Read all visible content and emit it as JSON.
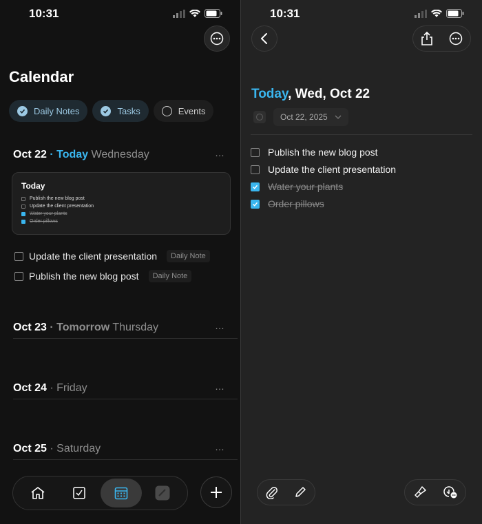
{
  "left": {
    "status": {
      "time": "10:31"
    },
    "title": "Calendar",
    "filters": [
      {
        "label": "Daily Notes",
        "checked": true
      },
      {
        "label": "Tasks",
        "checked": true
      },
      {
        "label": "Events",
        "checked": false
      }
    ],
    "days": [
      {
        "date": "Oct 22",
        "sep": " · ",
        "rel": "Today",
        "weekday": "Wednesday"
      },
      {
        "date": "Oct 23",
        "sep": " · ",
        "rel": "Tomorrow",
        "weekday": "Thursday"
      },
      {
        "date": "Oct 24",
        "sep": " · ",
        "rel": "",
        "weekday": "Friday"
      },
      {
        "date": "Oct 25",
        "sep": " · ",
        "rel": "",
        "weekday": "Saturday"
      }
    ],
    "note_card": {
      "title": "Today",
      "items": [
        {
          "text": "Publish the new blog post",
          "done": false
        },
        {
          "text": "Update the client presentation",
          "done": false
        },
        {
          "text": "Water your plants",
          "done": true
        },
        {
          "text": "Order pillows",
          "done": true
        }
      ]
    },
    "tasks": [
      {
        "text": "Update the client presentation",
        "tag": "Daily Note"
      },
      {
        "text": "Publish the new blog post",
        "tag": "Daily Note"
      }
    ],
    "more_icon": "…",
    "tabbar": [
      "home-icon",
      "checkbox-icon",
      "calendar-icon",
      "app-icon"
    ],
    "plus_icon": "plus-icon"
  },
  "right": {
    "status": {
      "time": "10:31"
    },
    "heading_today": "Today",
    "heading_rest": ", Wed, Oct 22",
    "date_value": "Oct 22, 2025",
    "tasks": [
      {
        "text": "Publish the new blog post",
        "done": false
      },
      {
        "text": "Update the client presentation",
        "done": false
      },
      {
        "text": "Water your plants",
        "done": true
      },
      {
        "text": "Order pillows",
        "done": true
      }
    ]
  },
  "colors": {
    "accent": "#3ab6ef",
    "chip_text": "#9cc9e3",
    "bg_left": "#121212",
    "bg_right": "#232323"
  }
}
